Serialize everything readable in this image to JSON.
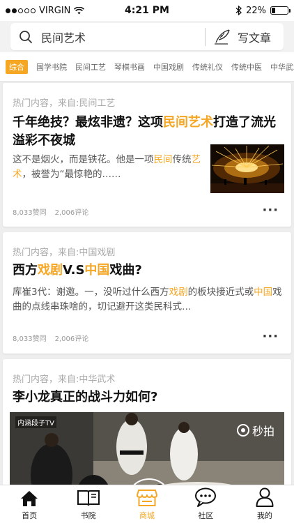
{
  "status": {
    "carrier": "VIRGIN",
    "time": "4:21 PM",
    "battery": "22%",
    "battery_fraction": 0.22
  },
  "search": {
    "query": "民间艺术",
    "write_label": "写文章"
  },
  "categories": [
    "综合",
    "国学书院",
    "民间工艺",
    "琴棋书画",
    "中国戏剧",
    "传统礼仪",
    "传统中医",
    "中华武术"
  ],
  "cards": [
    {
      "source": "热门内容，来自:民间工艺",
      "title_parts": [
        "千年绝技？最炫非遗？这项",
        "民间艺术",
        "打造了流光溢彩不夜城"
      ],
      "excerpt_parts": [
        "这不是烟火，而是铁花。他是一项",
        "民间",
        "传统",
        "艺术",
        "，被誉为“最惊艳的……"
      ],
      "likes": "8,033赞同",
      "comments": "2,006评论"
    },
    {
      "source": "热门内容，来自:中国戏剧",
      "title_parts": [
        "西方",
        "戏剧",
        "V.S",
        "中国",
        "戏曲?"
      ],
      "excerpt_parts": [
        "库崔3代：谢邀。一，没听过什么西方",
        "戏剧",
        "的板块接近式或",
        "中国",
        "戏曲的点线串珠啥的，切记避开这类民科式…"
      ],
      "likes": "8,033赞同",
      "comments": "2,006评论"
    },
    {
      "source": "热门内容，来自:中华武术",
      "title": "李小龙真正的战斗力如何?",
      "video_watermark": "内涵段子TV",
      "video_logo": "秒拍"
    }
  ],
  "tabs": [
    {
      "label": "首页",
      "icon": "home-icon"
    },
    {
      "label": "书院",
      "icon": "book-icon"
    },
    {
      "label": "商城",
      "icon": "shop-icon"
    },
    {
      "label": "社区",
      "icon": "chat-icon"
    },
    {
      "label": "我的",
      "icon": "user-icon"
    }
  ],
  "colors": {
    "accent": "#f5a623"
  }
}
